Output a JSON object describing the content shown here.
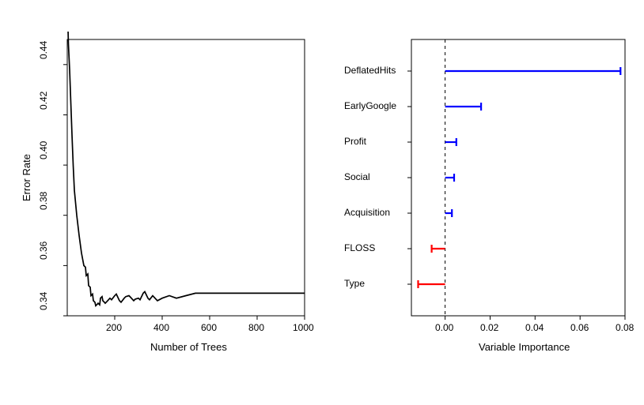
{
  "chart_data": [
    {
      "type": "line",
      "xlabel": "Number of Trees",
      "ylabel": "Error Rate",
      "xlim": [
        0,
        1000
      ],
      "ylim": [
        0.34,
        0.45
      ],
      "x_ticks": [
        200,
        400,
        600,
        800,
        1000
      ],
      "y_ticks": [
        0.34,
        0.36,
        0.38,
        0.4,
        0.42,
        0.44
      ],
      "series": [
        {
          "name": "error",
          "x": [
            1,
            3,
            5,
            10,
            15,
            20,
            25,
            30,
            40,
            50,
            60,
            70,
            80,
            90,
            100,
            110,
            120,
            130,
            140,
            150,
            160,
            180,
            200,
            220,
            240,
            260,
            280,
            300,
            320,
            340,
            360,
            380,
            400,
            430,
            460,
            500,
            540,
            580,
            620,
            660,
            700,
            740,
            780,
            820,
            860,
            900,
            940,
            1000
          ],
          "y": [
            0.465,
            0.455,
            0.448,
            0.438,
            0.425,
            0.412,
            0.4,
            0.39,
            0.38,
            0.372,
            0.365,
            0.36,
            0.356,
            0.352,
            0.348,
            0.346,
            0.344,
            0.345,
            0.347,
            0.346,
            0.345,
            0.347,
            0.348,
            0.346,
            0.347,
            0.348,
            0.346,
            0.347,
            0.349,
            0.347,
            0.348,
            0.346,
            0.347,
            0.348,
            0.347,
            0.348,
            0.349,
            0.349,
            0.349,
            0.349,
            0.349,
            0.349,
            0.349,
            0.349,
            0.349,
            0.349,
            0.349,
            0.349
          ]
        }
      ]
    },
    {
      "type": "bar",
      "orientation": "horizontal",
      "xlabel": "Variable Importance",
      "ylabel": "",
      "xlim": [
        -0.015,
        0.08
      ],
      "x_ticks": [
        0.0,
        0.02,
        0.04,
        0.06,
        0.08
      ],
      "categories": [
        "DeflatedHits",
        "EarlyGoogle",
        "Profit",
        "Social",
        "Acquisition",
        "FLOSS",
        "Type"
      ],
      "values": [
        0.078,
        0.016,
        0.005,
        0.004,
        0.003,
        -0.006,
        -0.012
      ],
      "zero_line": true,
      "color_positive": "#0000ff",
      "color_negative": "#ff0000"
    }
  ]
}
